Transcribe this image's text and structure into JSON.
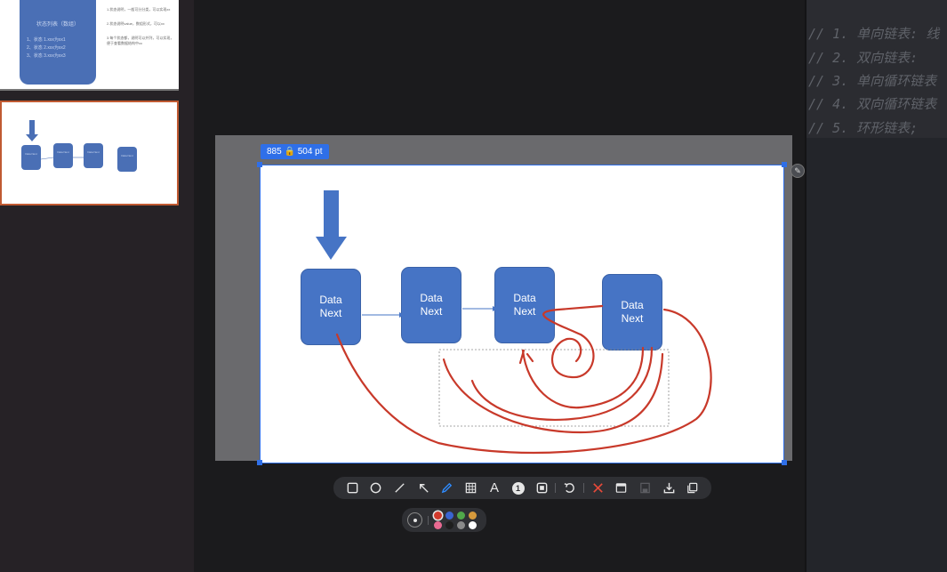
{
  "slide_1": {
    "title": "状态列表（数组）",
    "lines": [
      "1、状态  1.xxx为xx1",
      "2、状态  2.xxx为xx2",
      "3、状态  3.xxx为xx3"
    ],
    "notes": [
      "1.状态说明，一般可分分类，可以实现xx",
      "2.状态说明value，数组形式，可以xx",
      "3.每个状态都，说明可以并列，可以实现，便于查看数据结构中xx"
    ]
  },
  "slide_2": {
    "nodes": [
      "Data Next",
      "Data Next",
      "Data Next",
      "Data Next"
    ]
  },
  "editor": {
    "lines": [
      "// 1. 单向链表:  线",
      "// 2. 双向链表:",
      "// 3. 单向循环链表",
      "// 4. 双向循环链表",
      "// 5. 环形链表;"
    ]
  },
  "capture": {
    "size_badge": "885 🔒 504  pt",
    "nodes": [
      {
        "line1": "Data",
        "line2": "Next"
      },
      {
        "line1": "Data",
        "line2": "Next"
      },
      {
        "line1": "Data",
        "line2": "Next"
      },
      {
        "line1": "Data",
        "line2": "Next"
      }
    ],
    "shape_color": "#4674c5",
    "pen_color": "#c8392a",
    "selection_color": "#2f6fe8"
  },
  "toolbar": {
    "tools": [
      "rectangle-icon",
      "ellipse-icon",
      "line-icon",
      "arrow-icon",
      "pen-icon",
      "mosaic-icon",
      "text-icon",
      "number-marker-icon",
      "frame-icon",
      "undo-icon",
      "cancel-icon",
      "window-icon",
      "save-disabled-icon",
      "download-icon",
      "copy-icon"
    ],
    "text_tool_label": "A",
    "number_tool_label": "1"
  },
  "colors": [
    "#d23a2c",
    "#3a64d0",
    "#50a84a",
    "#d79a3c",
    "#e96a92",
    "#1e1e1e",
    "#8a8a8a",
    "#ffffff"
  ]
}
